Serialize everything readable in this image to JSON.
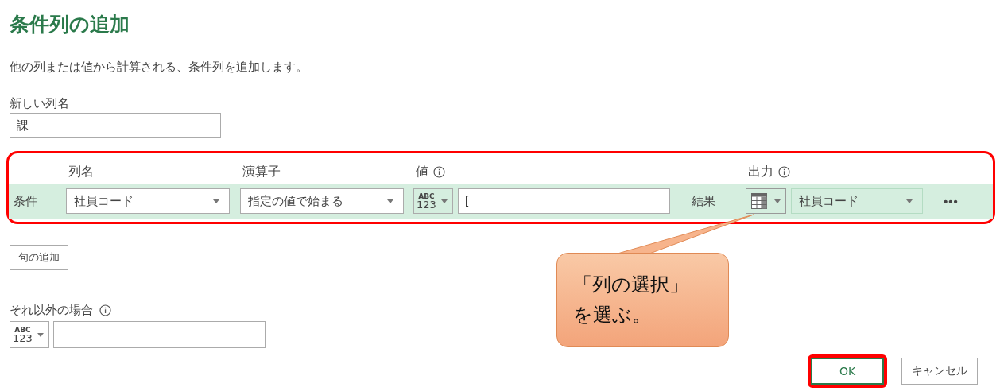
{
  "title": "条件列の追加",
  "description": "他の列または値から計算される、条件列を追加します。",
  "new_column": {
    "label": "新しい列名",
    "value": "課"
  },
  "condition_headers": [
    {
      "label": "列名",
      "info": false
    },
    {
      "label": "演算子",
      "info": false
    },
    {
      "label": "値",
      "info": true
    },
    {
      "label": "出力",
      "info": true
    }
  ],
  "clause": {
    "label": "条件",
    "column": "社員コード",
    "operator": "指定の値で始まる",
    "value_type": [
      "ABC",
      "123"
    ],
    "value": "[",
    "result_label": "結果",
    "output": "社員コード",
    "more": "•••",
    "highlighted": true
  },
  "add_clause_button": "句の追加",
  "otherwise": {
    "label": "それ以外の場合",
    "info": true,
    "value_type": [
      "ABC",
      "123"
    ]
  },
  "buttons": [
    {
      "label": "OK",
      "kind": "primary",
      "highlighted": true
    },
    {
      "label": "キャンセル",
      "kind": "secondary",
      "highlighted": false
    }
  ],
  "callout": {
    "lines": [
      "「列の選択」",
      "を選ぶ。"
    ]
  }
}
